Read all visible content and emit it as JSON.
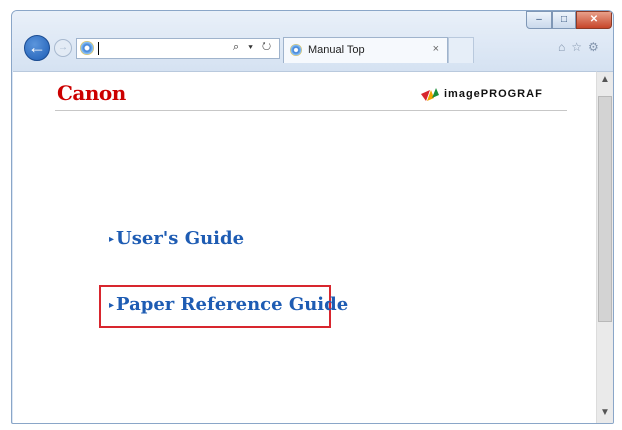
{
  "browser": {
    "window_controls": {
      "minimize": "–",
      "maximize": "□",
      "close": "✕"
    },
    "back_glyph": "←",
    "forward_glyph": "→",
    "address": {
      "value": "",
      "tools": "⌕ ▾ ↻"
    },
    "tab": {
      "title": "Manual Top",
      "close": "×"
    },
    "right_icons": "⌂☆⚙"
  },
  "page": {
    "brand": "Canon",
    "product_logo_text": "imagePROGRAF",
    "links": [
      {
        "label": "User's Guide",
        "arrow": "▸"
      },
      {
        "label": "Paper Reference Guide",
        "arrow": "▸",
        "highlighted": true
      }
    ],
    "colors": {
      "brand_red": "#cc0000",
      "link_blue": "#1e5cb3",
      "highlight_red": "#d8262e"
    }
  },
  "scrollbar": {
    "up": "▲",
    "down": "▼"
  }
}
